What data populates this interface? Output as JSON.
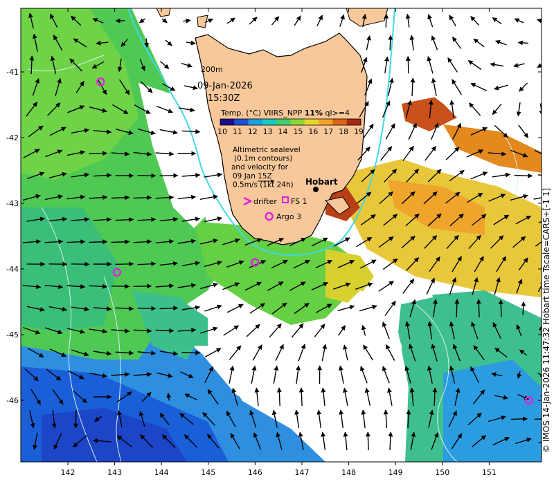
{
  "map": {
    "date": "09-Jan-2026",
    "time": "15:30Z",
    "depth_label": "200m",
    "colorbar": {
      "title_prefix": "Temp. (°C) VIIRS_NPP ",
      "title_bold": "11%",
      "title_suffix": " ql>=4",
      "ticks": [
        "10",
        "11",
        "12",
        "13",
        "14",
        "15",
        "16",
        "17",
        "18",
        "19"
      ],
      "colors": [
        "#1a0f8c",
        "#1f4fd6",
        "#1d9fe0",
        "#19c9c4",
        "#3fd16c",
        "#8fd63a",
        "#e8d431",
        "#f2a42a",
        "#df6419",
        "#a82a12"
      ]
    },
    "altimetry_note": [
      "Altimetric sealevel",
      "(0.1m contours)",
      "and velocity for",
      "09 Jan 15Z",
      "0.5m/s (1kt 24h)"
    ],
    "legend": {
      "drifter": "drifter",
      "fs": "FS 1",
      "argo": "Argo 3"
    },
    "city": "Hobart",
    "x_ticks": [
      "142",
      "143",
      "144",
      "145",
      "146",
      "147",
      "148",
      "149",
      "150",
      "151"
    ],
    "y_ticks": [
      "-41",
      "-42",
      "-43",
      "-44",
      "-45",
      "-46"
    ],
    "side_caption": "© IMOS 14-Jan-2026 11:47:32 Hobart time Tscale=CARS+[-1 1]",
    "accent": {
      "marker": "#e020e0",
      "isobath": "#3fd8e8",
      "land": "#f8c89a"
    },
    "argo_floats": [
      {
        "lon": 142.7,
        "lat": -41.15
      },
      {
        "lon": 143.05,
        "lat": -44.05
      },
      {
        "lon": 146.0,
        "lat": -43.9
      },
      {
        "lon": 146.3,
        "lat": -43.2
      },
      {
        "lon": 151.85,
        "lat": -46.0
      }
    ]
  }
}
